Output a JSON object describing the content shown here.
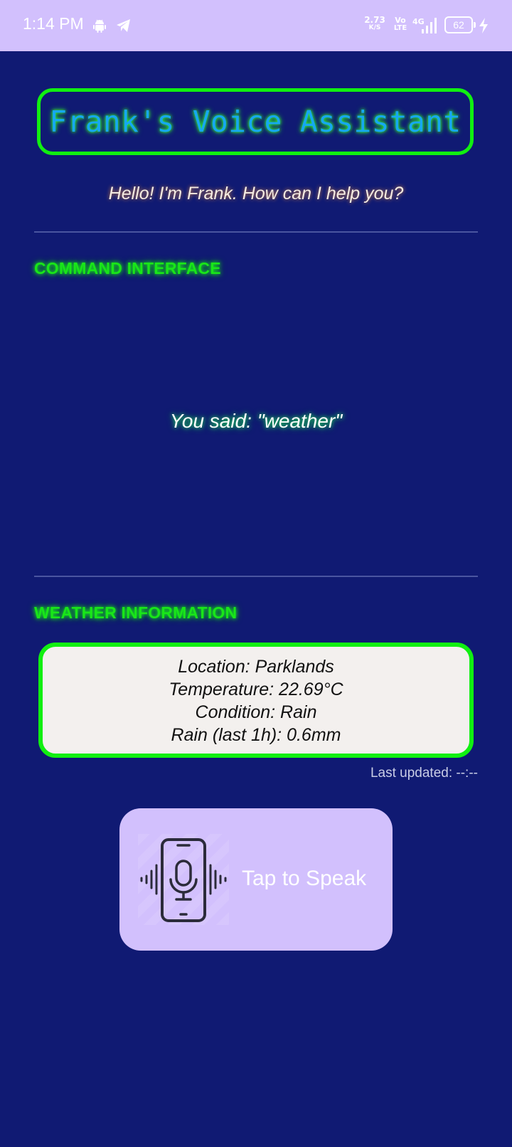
{
  "status_bar": {
    "time": "1:14 PM",
    "app_icons": [
      "android-icon",
      "telegram-icon"
    ],
    "net_speed_value": "2.73",
    "net_speed_unit": "K/S",
    "volte_top": "Vo",
    "volte_bottom": "LTE",
    "network_type": "4G",
    "signal_icon": "signal-bars-icon",
    "battery_level": "62",
    "charging_icon": "charging-bolt-icon"
  },
  "header": {
    "title": "Frank's Voice Assistant",
    "greeting": "Hello! I'm Frank. How can I help you?"
  },
  "command_section": {
    "heading": "COMMAND INTERFACE",
    "transcript": "You said: \"weather\""
  },
  "weather_section": {
    "heading": "WEATHER INFORMATION",
    "location": "Location: Parklands",
    "temperature": "Temperature: 22.69°C",
    "condition": "Condition: Rain",
    "rain": "Rain (last 1h): 0.6mm",
    "last_updated": "Last updated: --:--"
  },
  "speak_button": {
    "label": "Tap to Speak",
    "icon": "phone-microphone-icon"
  },
  "colors": {
    "background": "#101a73",
    "status_bar": "#d2c0fd",
    "accent_green": "#11f011",
    "title_blue": "#16a8f0",
    "card_background": "#f3f0ee",
    "button_background": "#d2c0fd"
  }
}
